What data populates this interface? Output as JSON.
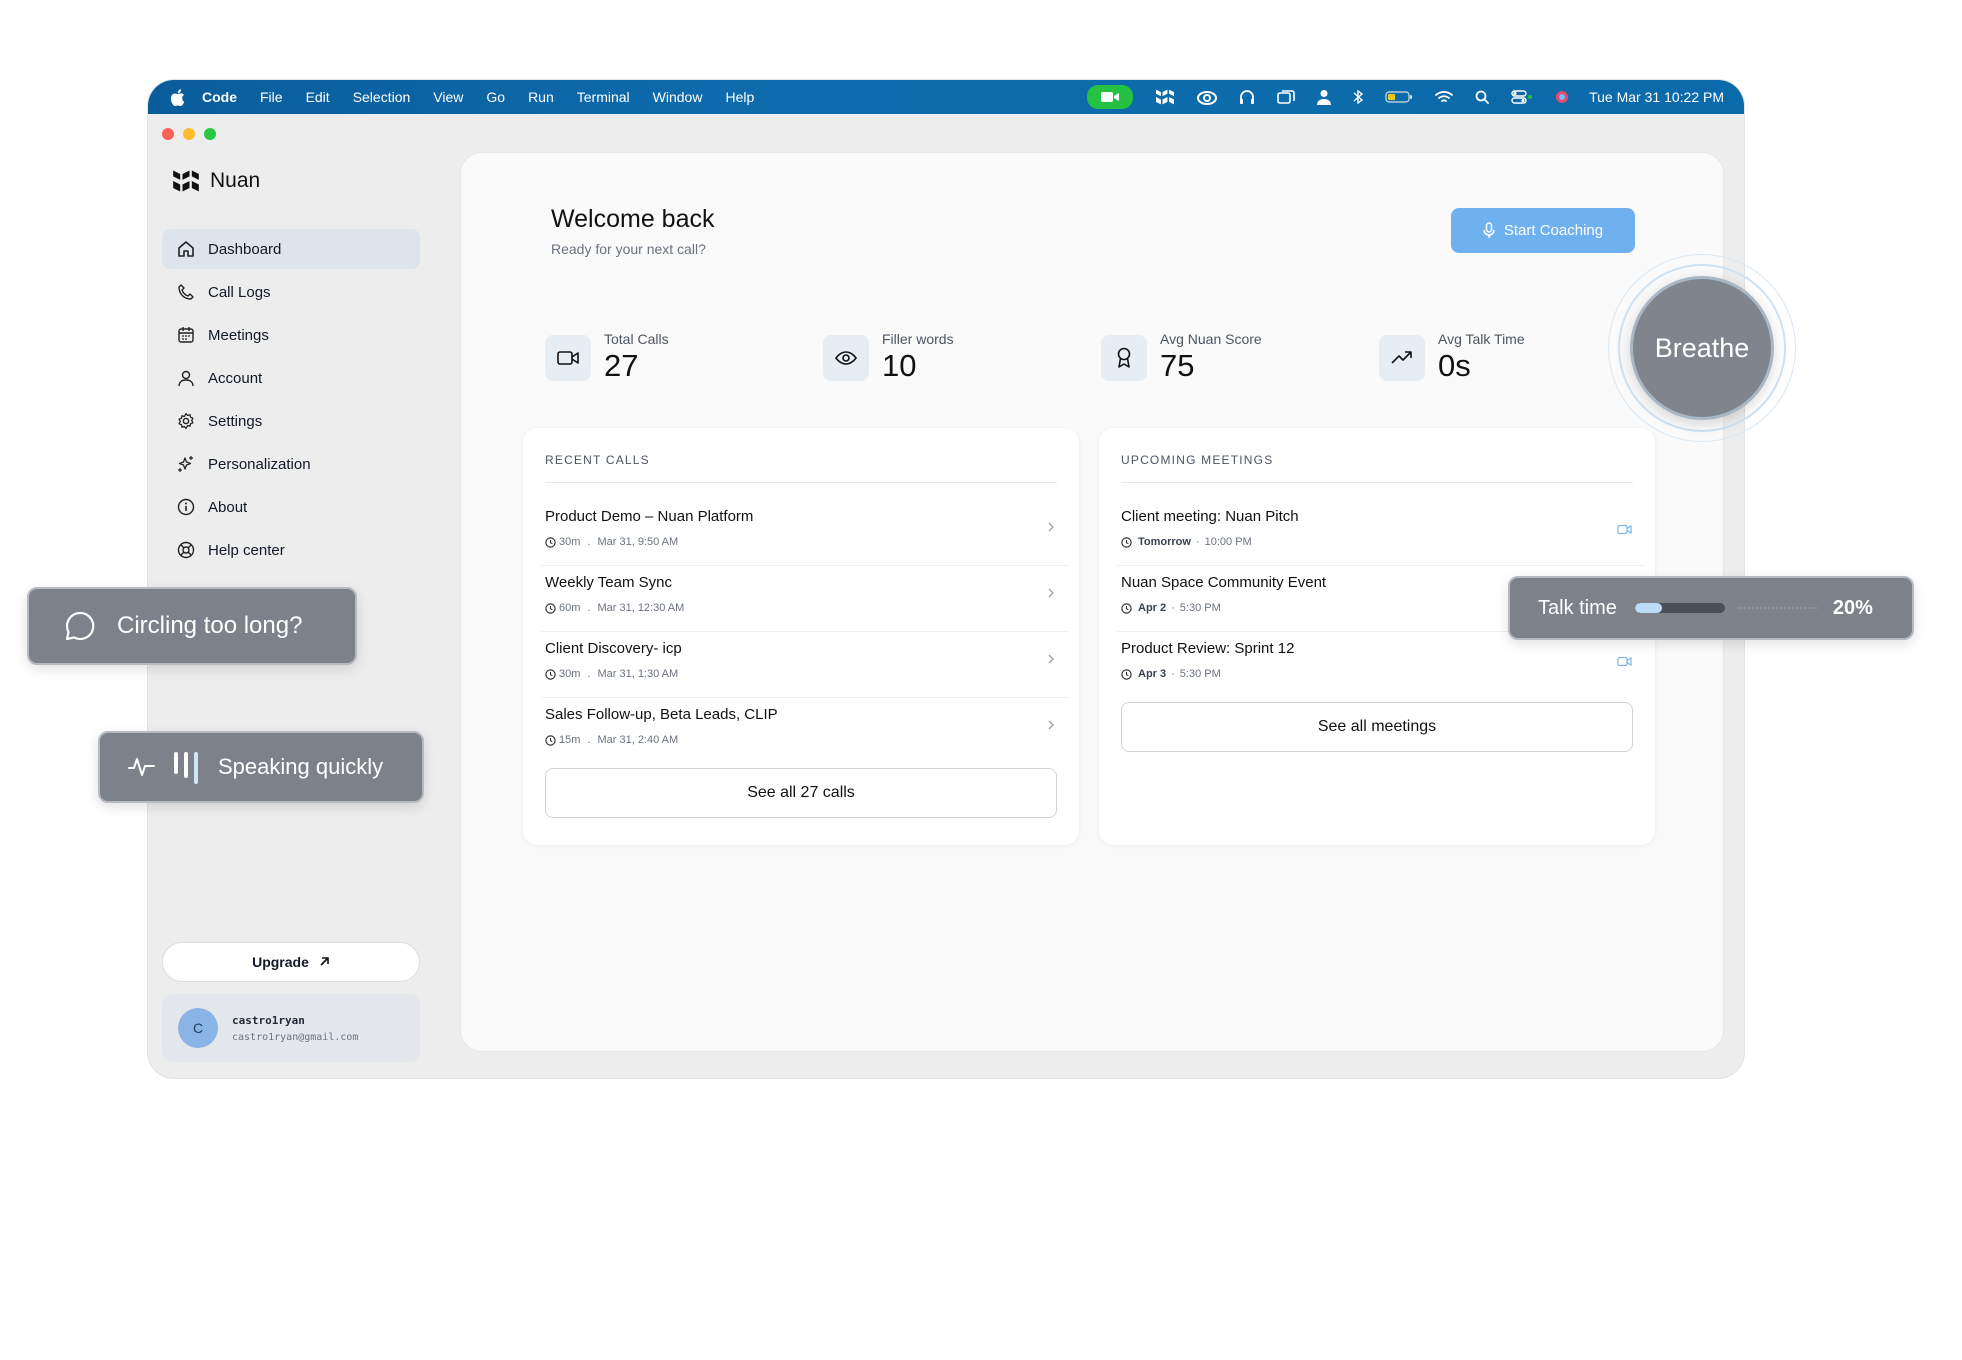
{
  "menubar": {
    "items": [
      "Code",
      "File",
      "Edit",
      "Selection",
      "View",
      "Go",
      "Run",
      "Terminal",
      "Window",
      "Help"
    ],
    "clock": "Tue Mar 31  10:22 PM"
  },
  "app": {
    "name": "Nuan"
  },
  "sidebar": {
    "items": [
      {
        "label": "Dashboard",
        "icon": "home-icon"
      },
      {
        "label": "Call Logs",
        "icon": "phone-icon"
      },
      {
        "label": "Meetings",
        "icon": "calendar-icon"
      },
      {
        "label": "Account",
        "icon": "user-icon"
      },
      {
        "label": "Settings",
        "icon": "gear-icon"
      },
      {
        "label": "Personalization",
        "icon": "sparkles-icon"
      },
      {
        "label": "About",
        "icon": "info-icon"
      },
      {
        "label": "Help center",
        "icon": "lifebuoy-icon"
      }
    ],
    "upgrade_label": "Upgrade",
    "user": {
      "initial": "C",
      "name": "castro1ryan",
      "email": "castro1ryan@gmail.com"
    }
  },
  "header": {
    "title": "Welcome back",
    "subtitle": "Ready for your next call?",
    "start_button": "Start Coaching"
  },
  "stats": [
    {
      "label": "Total Calls",
      "value": "27",
      "icon": "video-icon"
    },
    {
      "label": "Filler words",
      "value": "10",
      "icon": "eye-icon"
    },
    {
      "label": "Avg Nuan Score",
      "value": "75",
      "icon": "award-icon"
    },
    {
      "label": "Avg Talk Time",
      "value": "0s",
      "icon": "trending-up-icon"
    }
  ],
  "recent_calls": {
    "title": "RECENT CALLS",
    "rows": [
      {
        "title": "Product Demo – Nuan Platform",
        "duration": "30m",
        "date": "Mar 31, 9:50 AM"
      },
      {
        "title": "Weekly Team Sync",
        "duration": "60m",
        "date": "Mar 31, 12:30 AM"
      },
      {
        "title": "Client Discovery- icp",
        "duration": "30m",
        "date": "Mar 31, 1:30 AM"
      },
      {
        "title": "Sales Follow-up, Beta Leads, CLIP",
        "duration": "15m",
        "date": "Mar 31, 2:40 AM"
      }
    ],
    "separator": ".",
    "see_all": "See all 27 calls"
  },
  "upcoming_meetings": {
    "title": "UPCOMING MEETINGS",
    "rows": [
      {
        "title": "Client meeting: Nuan Pitch",
        "day": "Tomorrow",
        "time": "10:00 PM"
      },
      {
        "title": "Nuan Space Community Event",
        "day": "Apr 2",
        "time": "5:30 PM"
      },
      {
        "title": "Product Review: Sprint 12",
        "day": "Apr 3",
        "time": "5:30 PM"
      }
    ],
    "separator": "·",
    "see_all": "See all meetings"
  },
  "overlays": {
    "circling": "Circling too long?",
    "speaking": "Speaking quickly",
    "talk_label": "Talk time",
    "talk_pct": "20%",
    "talk_fraction": 0.3,
    "breathe": "Breathe"
  },
  "colors": {
    "accent": "#6fb1ee",
    "overlay": "#7d818a",
    "menubar": "#0b6aa9",
    "facetime": "#25c143"
  }
}
